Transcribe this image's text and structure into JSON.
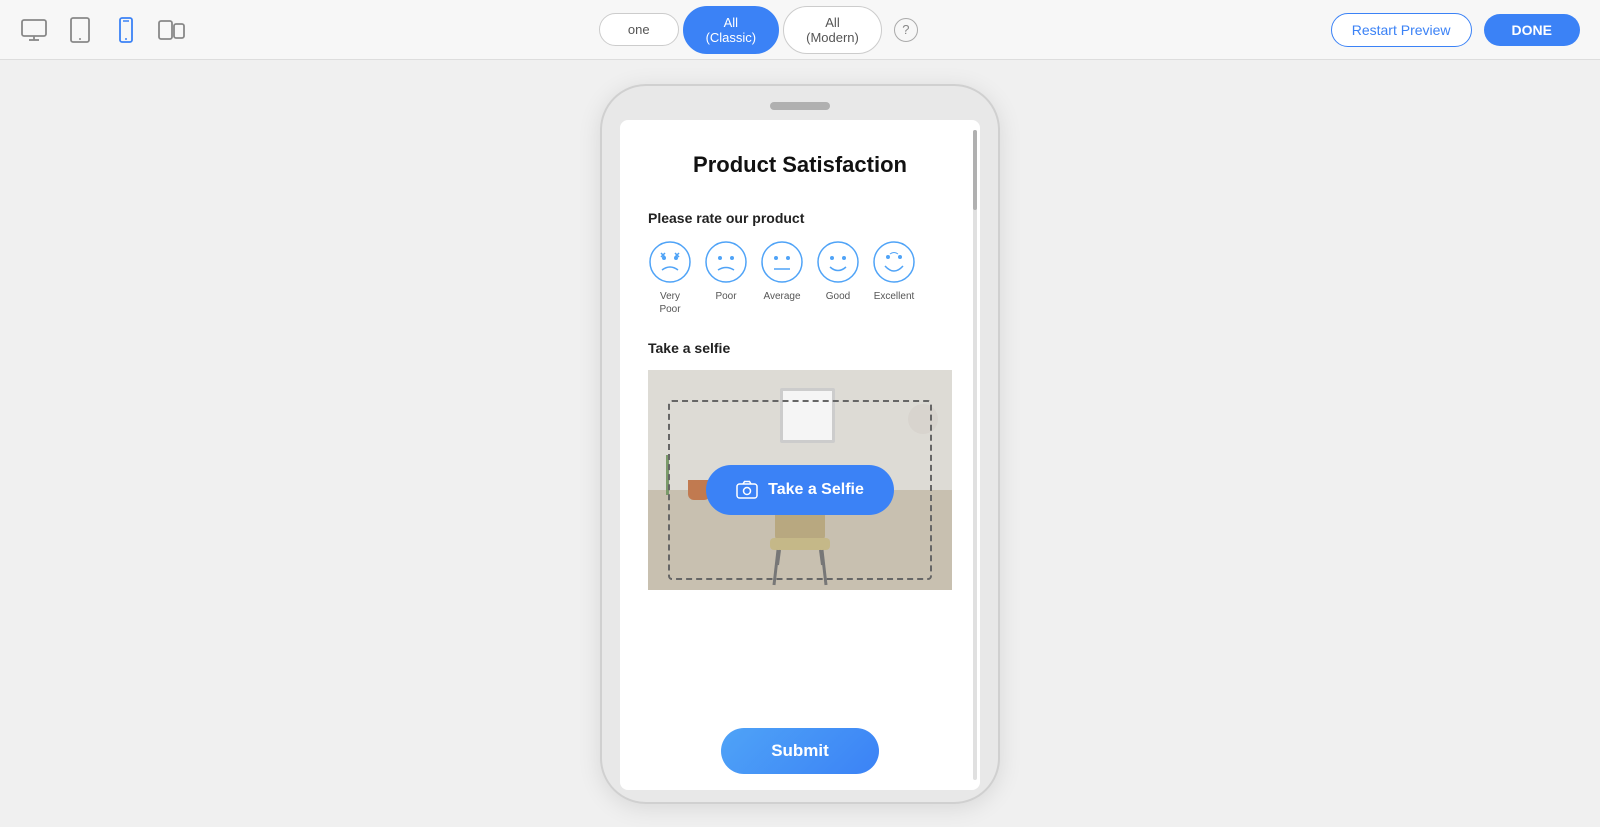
{
  "topbar": {
    "devices": [
      {
        "name": "desktop",
        "label": "Desktop",
        "active": false
      },
      {
        "name": "tablet",
        "label": "Tablet",
        "active": false
      },
      {
        "name": "mobile",
        "label": "Mobile",
        "active": true
      },
      {
        "name": "split",
        "label": "Split",
        "active": false
      }
    ],
    "tabs": [
      {
        "id": "one",
        "label": "One",
        "active": false
      },
      {
        "id": "all-classic",
        "label": "All\n(Classic)",
        "line1": "All",
        "line2": "(Classic)",
        "active": true
      },
      {
        "id": "all-modern",
        "label": "All\n(Modern)",
        "line1": "All",
        "line2": "(Modern)",
        "active": false
      }
    ],
    "help_label": "?",
    "restart_label": "Restart Preview",
    "done_label": "DONE"
  },
  "survey": {
    "title": "Product Satisfaction",
    "rating_question": "Please rate our product",
    "rating_options": [
      {
        "emoji": "very_poor",
        "label": "Very\nPoor"
      },
      {
        "emoji": "poor",
        "label": "Poor"
      },
      {
        "emoji": "average",
        "label": "Average"
      },
      {
        "emoji": "good",
        "label": "Good"
      },
      {
        "emoji": "excellent",
        "label": "Excellent"
      }
    ],
    "selfie_label": "Take a selfie",
    "selfie_button": "Take a Selfie",
    "submit_label": "Submit"
  }
}
